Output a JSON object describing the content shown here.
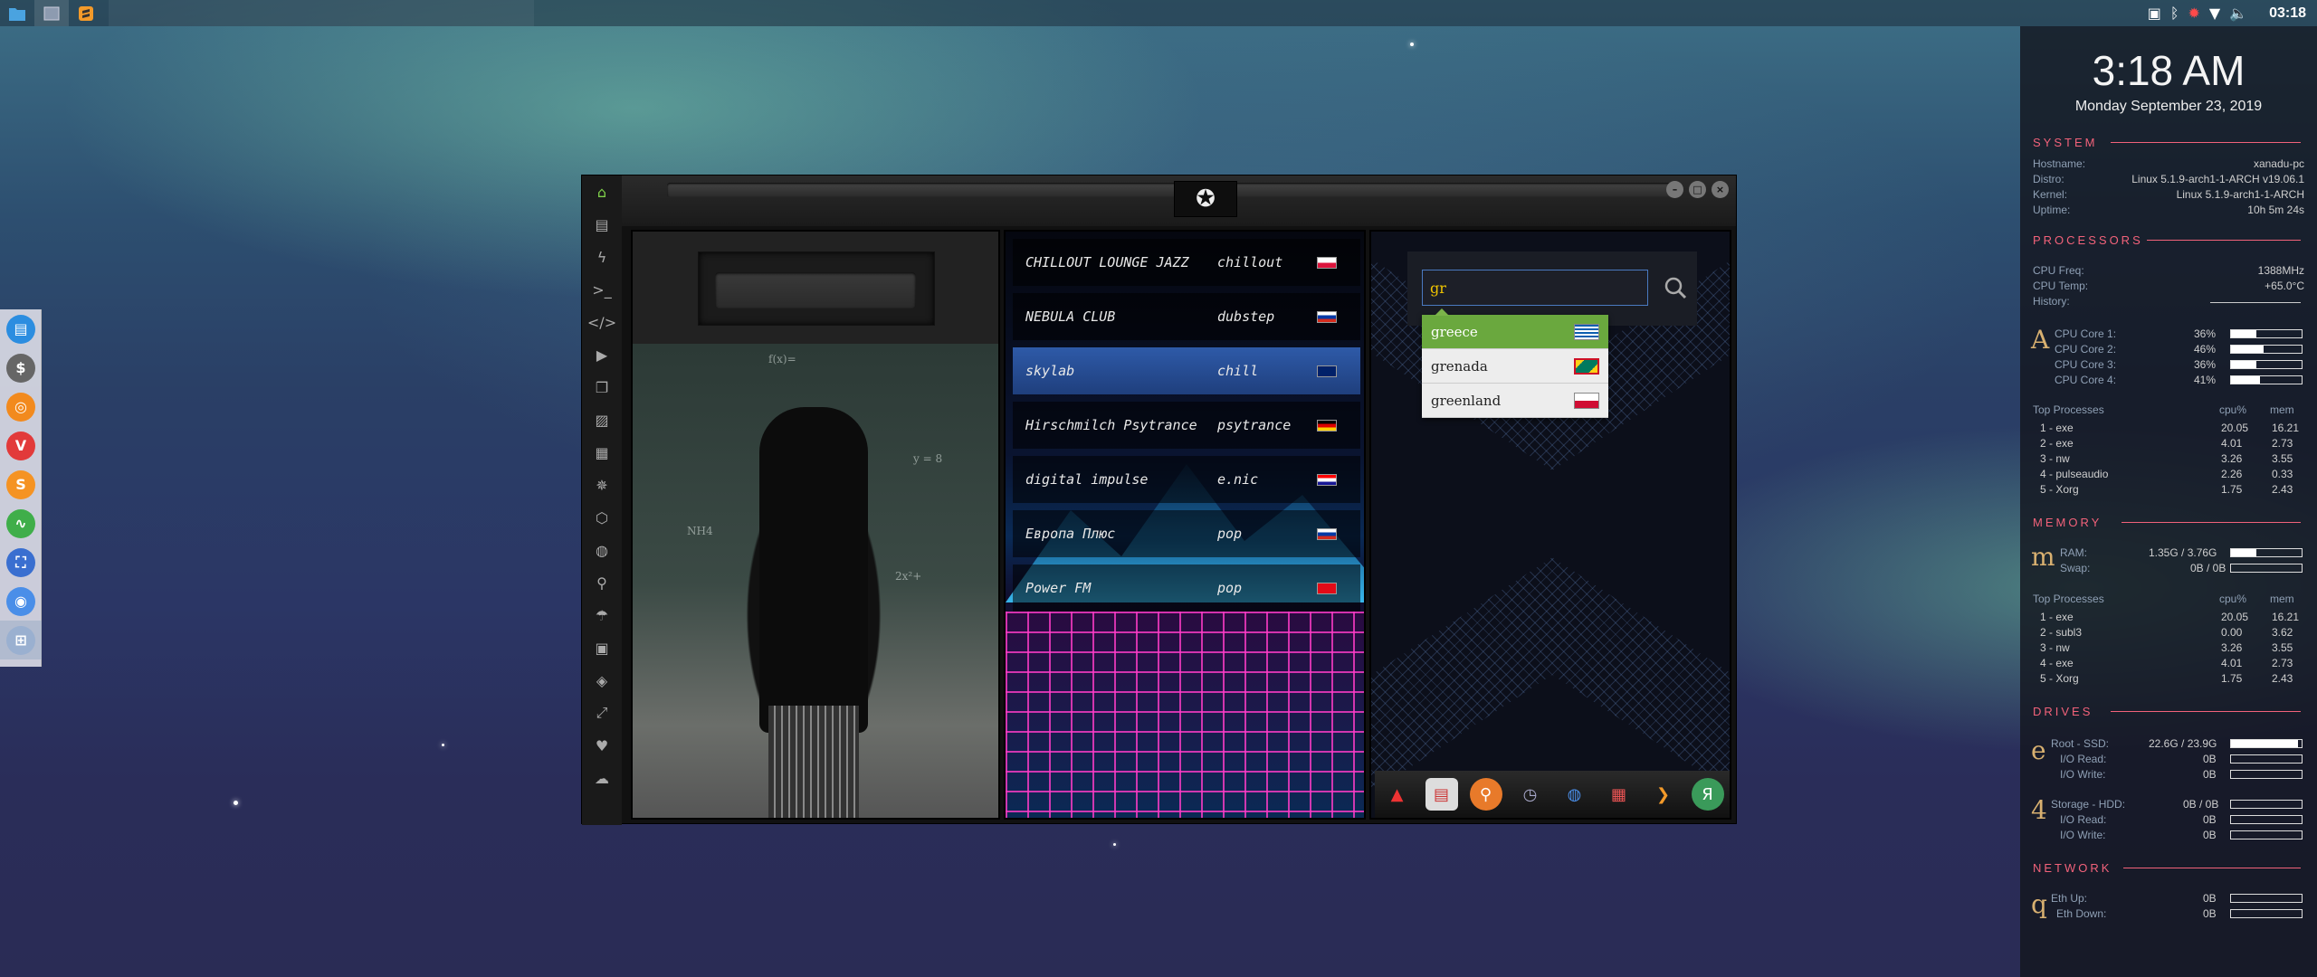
{
  "top_panel": {
    "clock": "03:18",
    "tray_icons": [
      "screenshot-icon",
      "bluetooth-icon",
      "settings-icon",
      "wifi-icon",
      "volume-icon"
    ]
  },
  "dock": {
    "items": [
      "files",
      "terminal-dollar",
      "ubuntu-like",
      "vivaldi",
      "sublime-s",
      "monitor-pulse",
      "screenshot-app",
      "chrome",
      "grid"
    ]
  },
  "radio_app": {
    "stations": [
      {
        "name": "CHILLOUT LOUNGE JAZZ",
        "genre": "chillout",
        "flag": "pl"
      },
      {
        "name": "NEBULA CLUB",
        "genre": "dubstep",
        "flag": "ru"
      },
      {
        "name": "skylab",
        "genre": "chill",
        "flag": "gb"
      },
      {
        "name": "Hirschmilch Psytrance",
        "genre": "psytrance",
        "flag": "de"
      },
      {
        "name": "digital impulse",
        "genre": "e.nic",
        "flag": "hr"
      },
      {
        "name": "Европа Плюс",
        "genre": "pop",
        "flag": "ru"
      },
      {
        "name": "Power FM",
        "genre": "pop",
        "flag": "tr"
      }
    ],
    "search": {
      "value": "gr",
      "suggestions": [
        "greece",
        "grenada",
        "greenland"
      ]
    },
    "chalk_lines": [
      "f(x)=",
      "y = 8",
      "NH4",
      "2x²+"
    ]
  },
  "conky": {
    "time": "3:18 AM",
    "date": "Monday September 23, 2019",
    "system": {
      "title": "SYSTEM",
      "rows": [
        {
          "label": "Hostname:",
          "value": "xanadu-pc"
        },
        {
          "label": "Distro:",
          "value": "Linux 5.1.9-arch1-1-ARCH v19.06.1"
        },
        {
          "label": "Kernel:",
          "value": "Linux 5.1.9-arch1-1-ARCH"
        },
        {
          "label": "Uptime:",
          "value": "10h 5m 24s"
        }
      ]
    },
    "processors": {
      "title": "PROCESSORS",
      "freq_label": "CPU Freq:",
      "freq": "1388MHz",
      "temp_label": "CPU Temp:",
      "temp": "+65.0°C",
      "history_label": "History:",
      "big_letter": "A",
      "cores": [
        {
          "label": "CPU Core 1:",
          "value": "36%",
          "fill": 0.36
        },
        {
          "label": "CPU Core 2:",
          "value": "46%",
          "fill": 0.46
        },
        {
          "label": "CPU Core 3:",
          "value": "36%",
          "fill": 0.36
        },
        {
          "label": "CPU Core 4:",
          "value": "41%",
          "fill": 0.41
        }
      ],
      "top_title": "Top Processes",
      "col_cpu": "cpu%",
      "col_mem": "mem",
      "procs": [
        {
          "rank": "1 - exe",
          "cpu": "20.05",
          "mem": "16.21"
        },
        {
          "rank": "2 - exe",
          "cpu": "4.01",
          "mem": "2.73"
        },
        {
          "rank": "3 - nw",
          "cpu": "3.26",
          "mem": "3.55"
        },
        {
          "rank": "4 - pulseaudio",
          "cpu": "2.26",
          "mem": "0.33"
        },
        {
          "rank": "5 - Xorg",
          "cpu": "1.75",
          "mem": "2.43"
        }
      ]
    },
    "memory": {
      "title": "MEMORY",
      "big_letter": "m",
      "ram_label": "RAM:",
      "ram": "1.35G / 3.76G",
      "ram_fill": 0.36,
      "swap_label": "Swap:",
      "swap": "0B / 0B",
      "swap_fill": 0,
      "top_title": "Top Processes",
      "col_cpu": "cpu%",
      "col_mem": "mem",
      "procs": [
        {
          "rank": "1 - exe",
          "cpu": "20.05",
          "mem": "16.21"
        },
        {
          "rank": "2 - subl3",
          "cpu": "0.00",
          "mem": "3.62"
        },
        {
          "rank": "3 - nw",
          "cpu": "3.26",
          "mem": "3.55"
        },
        {
          "rank": "4 - exe",
          "cpu": "4.01",
          "mem": "2.73"
        },
        {
          "rank": "5 - Xorg",
          "cpu": "1.75",
          "mem": "2.43"
        }
      ]
    },
    "drives": {
      "title": "DRIVES",
      "root_letter": "e",
      "root_label": "Root - SSD:",
      "root": "22.6G / 23.9G",
      "root_fill": 0.95,
      "root_read_label": "I/O Read:",
      "root_read": "0B",
      "root_write_label": "I/O Write:",
      "root_write": "0B",
      "storage_letter": "4",
      "storage_label": "Storage - HDD:",
      "storage": "0B / 0B",
      "storage_fill": 0,
      "storage_read_label": "I/O Read:",
      "storage_read": "0B",
      "storage_write_label": "I/O Write:",
      "storage_write": "0B"
    },
    "network": {
      "title": "NETWORK",
      "big_letter": "q",
      "up_label": "Eth Up:",
      "up": "0B",
      "down_label": "Eth Down:",
      "down": "0B"
    }
  },
  "colors": {
    "accent": "#f2627a",
    "selected_station": "#2e5aa8",
    "suggest_highlight": "#6aa83e",
    "search_text": "#f0c400"
  }
}
